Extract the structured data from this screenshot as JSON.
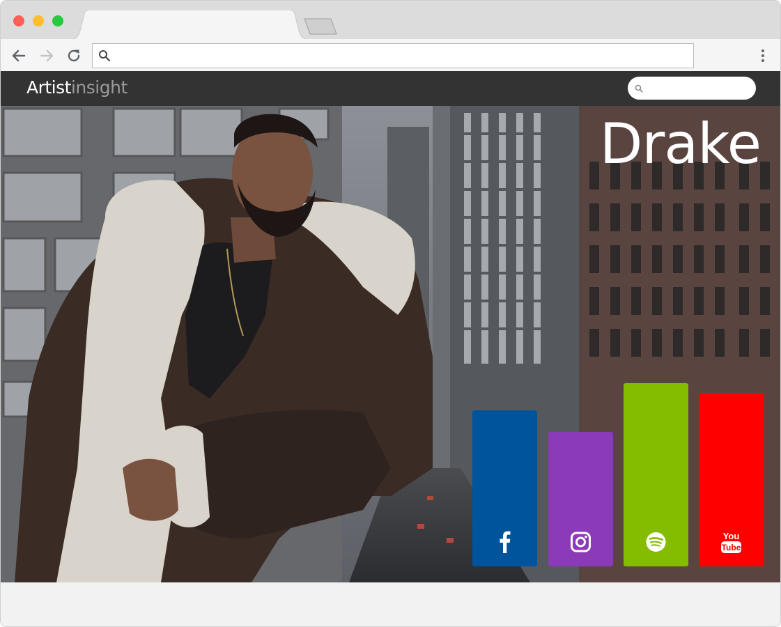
{
  "browser": {
    "address_value": "",
    "address_placeholder": ""
  },
  "site": {
    "logo_strong": "Artist",
    "logo_light": "insight",
    "search_placeholder": ""
  },
  "artist": {
    "name": "Drake"
  },
  "platforms": [
    {
      "name": "facebook",
      "icon": "facebook-icon",
      "color": "#00549b",
      "level": 0.8
    },
    {
      "name": "instagram",
      "icon": "instagram-icon",
      "color": "#8b3bb8",
      "level": 0.69
    },
    {
      "name": "spotify",
      "icon": "spotify-icon",
      "color": "#84bd00",
      "level": 0.94
    },
    {
      "name": "youtube",
      "icon": "youtube-icon",
      "color": "#ff0000",
      "level": 0.89
    }
  ],
  "colors": {
    "header_bg": "#333333",
    "logo_light": "#9a9a9a"
  }
}
